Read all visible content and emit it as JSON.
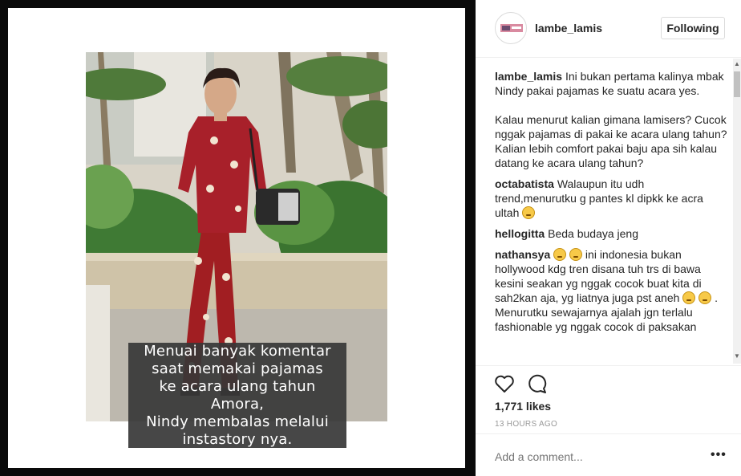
{
  "post": {
    "username": "lambe_lamis",
    "follow_label": "Following",
    "overlay_text": "Menuai banyak komentar\nsaat memakai pajamas\nke acara ulang tahun Amora,\nNindy membalas melalui\ninstastory nya."
  },
  "caption": {
    "user": "lambe_lamis",
    "text": "Ini bukan pertama kalinya mbak Nindy pakai pajamas ke suatu acara yes.\n\nKalau menurut kalian gimana lamisers? Cucok nggak pajamas di pakai ke acara ulang tahun?\nKalian lebih comfort pakai baju apa sih kalau datang ke acara ulang tahun?"
  },
  "comments": [
    {
      "user": "octabatista",
      "text_before": "Walaupun itu udh trend,menurutku g pantes kl dipkk ke acra ultah",
      "emoji_count": 1
    },
    {
      "user": "hellogitta",
      "text": "Beda budaya jeng"
    },
    {
      "user": "nathansya",
      "text_part1": "ini indonesia bukan hollywood kdg tren disana tuh trs di bawa kesini seakan yg nggak cocok buat kita di sah2kan aja, yg liatnya juga pst aneh",
      "text_part2": ". Menurutku sewajarnya ajalah jgn terlalu fashionable yg nggak cocok di paksakan"
    }
  ],
  "likes": "1,771 likes",
  "time": "13 HOURS AGO",
  "add_comment_placeholder": "Add a comment...",
  "more_label": "•••",
  "scroll": {
    "up": "▲",
    "down": "▼"
  }
}
